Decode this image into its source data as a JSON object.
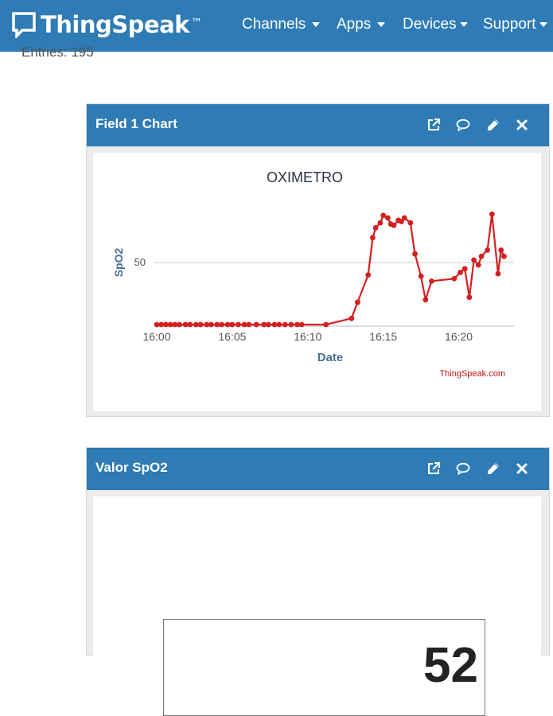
{
  "navbar": {
    "brand": "ThingSpeak",
    "trademark": "™",
    "menu": [
      {
        "label": "Channels"
      },
      {
        "label": "Apps"
      },
      {
        "label": "Devices"
      },
      {
        "label": "Support"
      }
    ]
  },
  "entries_label": "Entries: 195",
  "field_chart": {
    "header_title": "Field 1 Chart",
    "icons": [
      "external-link-icon",
      "comment-icon",
      "pencil-icon",
      "close-icon"
    ]
  },
  "spo2_widget": {
    "header_title": "Valor SpO2",
    "value": "52",
    "icons": [
      "external-link-icon",
      "comment-icon",
      "pencil-icon",
      "close-icon"
    ]
  },
  "colors": {
    "header": "#2e7bb5",
    "series": "#d62020",
    "axis_label": "#4a6c96"
  },
  "chart_data": {
    "type": "line",
    "title": "OXIMETRO",
    "xlabel": "Date",
    "ylabel": "SpO2",
    "credit": "ThingSpeak.com",
    "xticks": [
      "16:00",
      "16:05",
      "16:10",
      "16:15",
      "16:20"
    ],
    "yticks": [
      50
    ],
    "ylim": [
      0,
      95
    ],
    "xlim_minutes": [
      0,
      23.5
    ],
    "grid": true,
    "legend": "none",
    "series": [
      {
        "x": [
          0,
          0.3,
          0.6,
          0.9,
          1.2,
          1.5,
          1.9,
          2.2,
          2.6,
          2.9,
          3.3,
          3.6,
          4,
          4.3,
          4.7,
          5,
          5.4,
          5.8,
          6.1,
          6.6,
          7.1,
          7.4,
          7.8,
          8.1,
          8.5,
          8.9,
          9.3,
          9.6,
          11.2,
          12.9,
          13.3,
          14,
          14.3,
          14.5,
          14.8,
          15,
          15.3,
          15.5,
          15.7,
          16,
          16.2,
          16.4,
          16.8,
          17.1,
          17.5,
          17.8,
          18.2,
          19.7,
          20.1,
          20.4,
          20.7,
          21,
          21.3,
          21.5,
          21.9,
          22.2,
          22.6,
          22.8,
          23
        ],
        "y": [
          0,
          0,
          0,
          0,
          0,
          0,
          0,
          0,
          0,
          0,
          0,
          0,
          0,
          0,
          0,
          0,
          0,
          0,
          0,
          0,
          0,
          0,
          0,
          0,
          0,
          0,
          0,
          0,
          0,
          5,
          18,
          40,
          70,
          78,
          82,
          88,
          86,
          81,
          80,
          84,
          83,
          86,
          82,
          57,
          39,
          20,
          35,
          37,
          42,
          45,
          22,
          52,
          48,
          55,
          60,
          89,
          41,
          60,
          55
        ]
      }
    ]
  }
}
